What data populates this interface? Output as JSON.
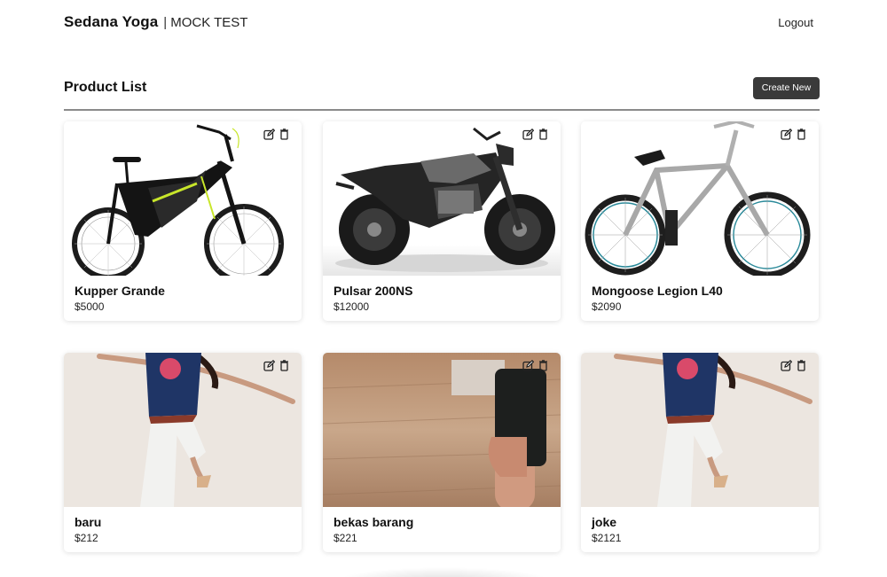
{
  "header": {
    "brand": "Sedana Yoga",
    "separator": "|",
    "subtitle": "MOCK TEST",
    "logout": "Logout"
  },
  "section": {
    "title": "Product List",
    "create_label": "Create New"
  },
  "products": [
    {
      "name": "Kupper Grande",
      "price": "$5000",
      "image": "mountain-ebike-photo"
    },
    {
      "name": "Pulsar 200NS",
      "price": "$12000",
      "image": "motorcycle-photo"
    },
    {
      "name": "Mongoose Legion L40",
      "price": "$2090",
      "image": "bmx-bike-photo"
    },
    {
      "name": "baru",
      "price": "$212",
      "image": "dancing-woman-photo"
    },
    {
      "name": "bekas barang",
      "price": "$221",
      "image": "hand-holding-phone-photo"
    },
    {
      "name": "joke",
      "price": "$2121",
      "image": "dancing-woman-photo"
    }
  ],
  "card_icons": {
    "edit": "edit-icon",
    "delete": "trash-icon"
  },
  "colors": {
    "button_bg": "#3a3a3a",
    "divider": "#8a8a8a"
  }
}
